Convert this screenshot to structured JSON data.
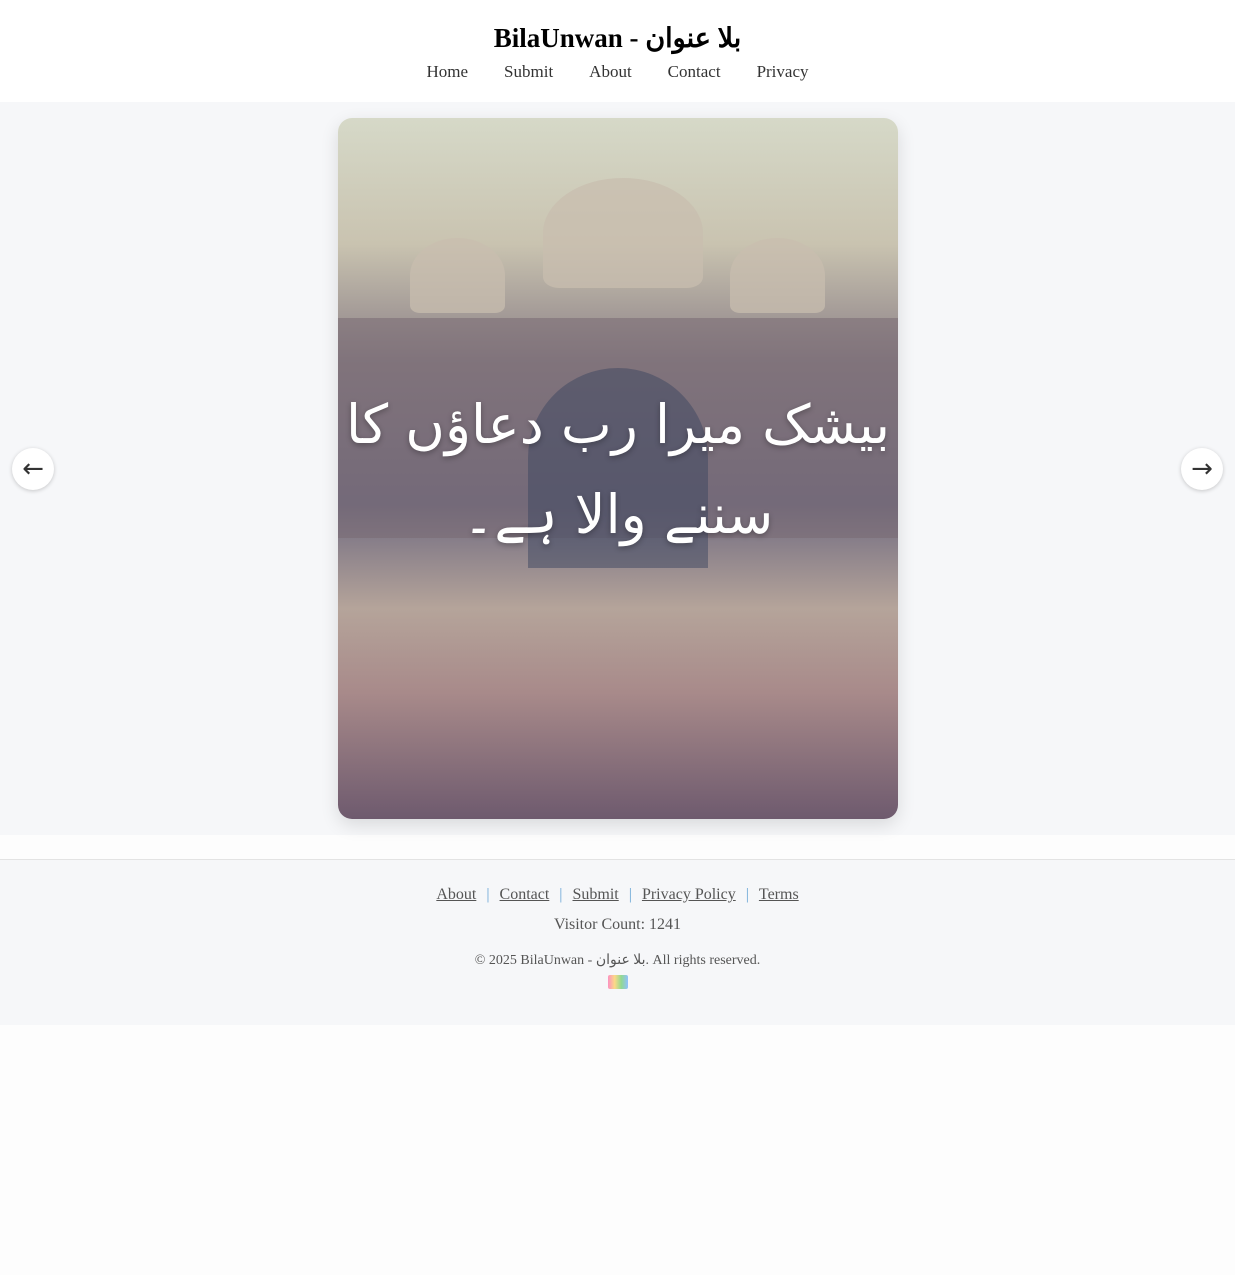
{
  "header": {
    "title": "BilaUnwan - بلا عنوان",
    "nav": [
      "Home",
      "Submit",
      "About",
      "Contact",
      "Privacy"
    ]
  },
  "slider": {
    "caption_line1": "بیشک میرا رب دعاؤں کا",
    "caption_line2": "سننے والا ہے۔",
    "prev_icon": "←",
    "next_icon": "→"
  },
  "footer": {
    "links": [
      "About",
      "Contact",
      "Submit",
      "Privacy Policy",
      "Terms"
    ],
    "separator": "|",
    "visitor_count": "Visitor Count: 1241",
    "copyright": "© 2025 BilaUnwan - بلا عنوان. All rights reserved."
  }
}
